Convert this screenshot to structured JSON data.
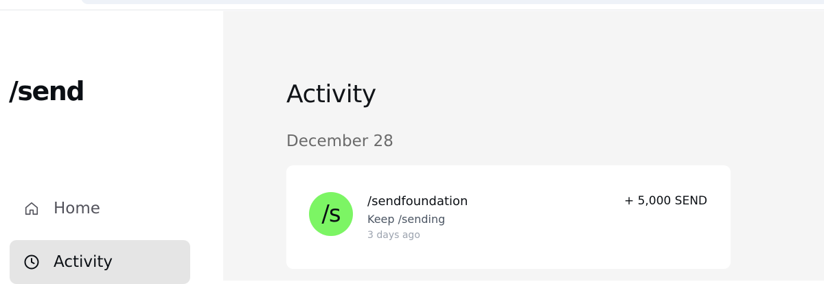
{
  "sidebar": {
    "logo": "/send",
    "nav": [
      {
        "label": "Home",
        "icon": "home-icon",
        "active": false
      },
      {
        "label": "Activity",
        "icon": "clock-icon",
        "active": true
      }
    ]
  },
  "main": {
    "title": "Activity",
    "groups": [
      {
        "date": "December 28",
        "items": [
          {
            "avatar_text": "/s",
            "name": "/sendfoundation",
            "note": "Keep /sending",
            "time": "3 days ago",
            "amount": "+ 5,000 SEND"
          }
        ]
      }
    ]
  },
  "colors": {
    "avatar_bg": "#7cf564",
    "active_nav_bg": "#e5e5e5",
    "main_bg": "#f5f5f5"
  }
}
